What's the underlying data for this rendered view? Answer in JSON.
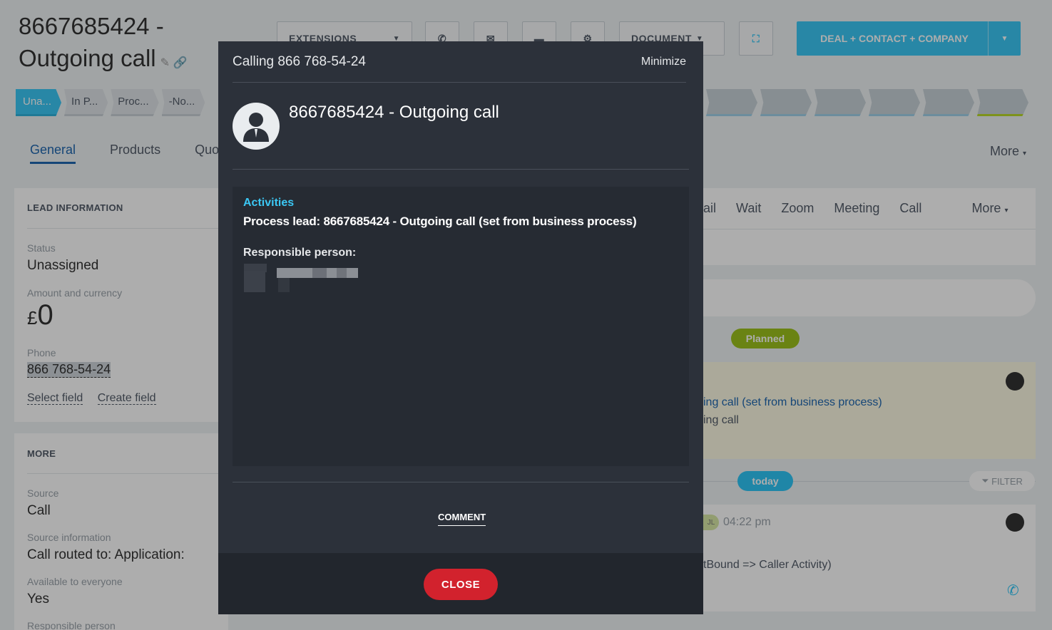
{
  "page": {
    "title": "8667685424 - Outgoing  call",
    "toolbar": {
      "extensions": "EXTENSIONS",
      "document": "DOCUMENT",
      "deal_button": "DEAL + CONTACT + COMPANY"
    },
    "stages": [
      "Una...",
      "In P...",
      "Proc...",
      "-No..."
    ],
    "tabs": [
      "General",
      "Products",
      "Quo"
    ],
    "more_tab": "More"
  },
  "left": {
    "lead_info": {
      "heading": "LEAD INFORMATION",
      "status_label": "Status",
      "status_value": "Unassigned",
      "amount_label": "Amount and currency",
      "currency_symbol": "£",
      "amount_value": "0",
      "phone_label": "Phone",
      "phone_value": "866 768-54-24",
      "select_field": "Select field",
      "create_field": "Create field"
    },
    "more": {
      "heading": "MORE",
      "source_label": "Source",
      "source_value": "Call",
      "source_info_label": "Source information",
      "source_info_value": "Call routed to: Application:",
      "available_label": "Available to everyone",
      "available_value": "Yes",
      "responsible_label": "Responsible person"
    }
  },
  "right": {
    "activity_tabs": [
      "ail",
      "Wait",
      "Zoom",
      "Meeting",
      "Call",
      "More"
    ],
    "planned_badge": "Planned",
    "planned_line1": "ing call (set from business process)",
    "planned_line2": "ing call",
    "today_badge": "today",
    "filter_label": "FILTER",
    "history_tag": "JL",
    "history_time": "04:22 pm",
    "history_text": "tBound => Caller Activity)"
  },
  "modal": {
    "title": "Calling 866 768-54-24",
    "minimize": "Minimize",
    "call_name": "8667685424 - Outgoing call",
    "activities_heading": "Activities",
    "activity_text": "Process lead: 8667685424 - Outgoing call (set from business process)",
    "responsible_label": "Responsible person:",
    "comment_tab": "COMMENT",
    "close_button": "CLOSE"
  },
  "colors": {
    "accent": "#3bc8f5",
    "modal_bg": "#2c313a",
    "close_red": "#d2222d",
    "planned_green": "#9dc21c",
    "today_blue": "#2fc6f6"
  }
}
